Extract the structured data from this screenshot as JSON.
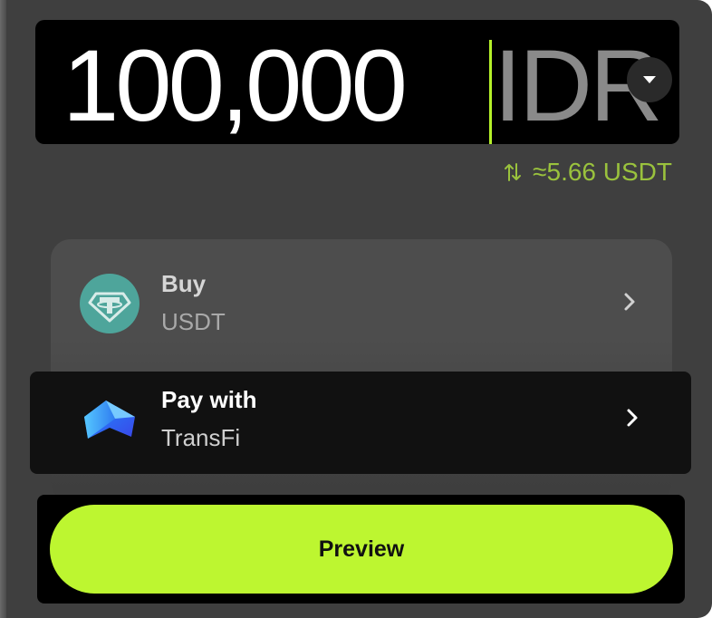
{
  "amount": {
    "value": "100,000",
    "currency": "IDR",
    "dropdown_icon": "caret-down-icon"
  },
  "conversion": {
    "icon": "swap-arrows-icon",
    "text": "≈5.66 USDT"
  },
  "buy": {
    "label": "Buy",
    "asset": "USDT",
    "icon": "tether-icon"
  },
  "pay_with": {
    "label": "Pay with",
    "provider": "TransFi",
    "icon": "transfi-logo-icon"
  },
  "preview_button": {
    "label": "Preview"
  },
  "colors": {
    "accent": "#bdf630",
    "caret": "#b5f12a",
    "conversion_text": "#9ac23d",
    "tether": "#4ea59b",
    "panel": "#3f3f3f"
  }
}
